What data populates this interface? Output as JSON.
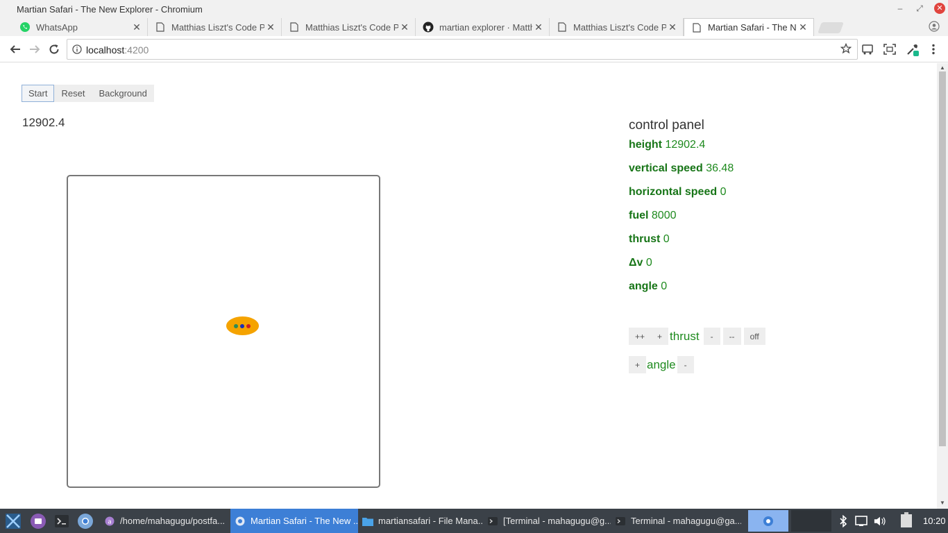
{
  "window": {
    "title": "Martian Safari - The New Explorer - Chromium",
    "minimize": "–",
    "maximize": "⤢",
    "close": "✕"
  },
  "tabs": [
    {
      "label": "WhatsApp",
      "icon": "whatsapp-icon"
    },
    {
      "label": "Matthias Liszt's Code P",
      "icon": "page-icon"
    },
    {
      "label": "Matthias Liszt's Code P",
      "icon": "page-icon"
    },
    {
      "label": "martian explorer · Matth",
      "icon": "github-icon"
    },
    {
      "label": "Matthias Liszt's Code P",
      "icon": "page-icon"
    },
    {
      "label": "Martian Safari - The Ne",
      "icon": "page-icon",
      "active": true
    }
  ],
  "tab_close_glyph": "✕",
  "address_bar": {
    "host": "localhost",
    "port": ":4200"
  },
  "page": {
    "buttons": {
      "start": "Start",
      "reset": "Reset",
      "background": "Background"
    },
    "height_readout": "12902.4"
  },
  "control_panel": {
    "title": "control panel",
    "rows": [
      {
        "label": "height",
        "value": "12902.4"
      },
      {
        "label": "vertical speed",
        "value": "36.48"
      },
      {
        "label": "horizontal speed",
        "value": "0"
      },
      {
        "label": "fuel",
        "value": "8000"
      },
      {
        "label": "thrust",
        "value": "0"
      },
      {
        "label": "Δv",
        "value": "0"
      },
      {
        "label": "angle",
        "value": "0"
      }
    ],
    "thrust_controls": {
      "plus_plus": "++",
      "plus": "+",
      "label": "thrust",
      "minus": "-",
      "minus_minus": "--",
      "off": "off"
    },
    "angle_controls": {
      "plus": "+",
      "label": "angle",
      "minus": "-"
    }
  },
  "lander": {
    "body_color": "#f5a300",
    "lights": [
      "#2e8b57",
      "#1a2fb5",
      "#d21f1f"
    ]
  },
  "taskbar": {
    "items": [
      {
        "label": "/home/mahagugu/postfa...",
        "icon": "app-icon"
      },
      {
        "label": "Martian Safari - The New ...",
        "icon": "chromium-icon",
        "active": true
      },
      {
        "label": "martiansafari - File Mana...",
        "icon": "folder-icon"
      },
      {
        "label": "[Terminal - mahagugu@g...",
        "icon": "terminal-icon"
      },
      {
        "label": "Terminal - mahagugu@ga...",
        "icon": "terminal-icon"
      }
    ],
    "clock": "10:20"
  },
  "colors": {
    "accent_green": "#1e8a1e",
    "taskbar_bg": "#3b4148",
    "taskbar_active": "#3d7fd6"
  }
}
